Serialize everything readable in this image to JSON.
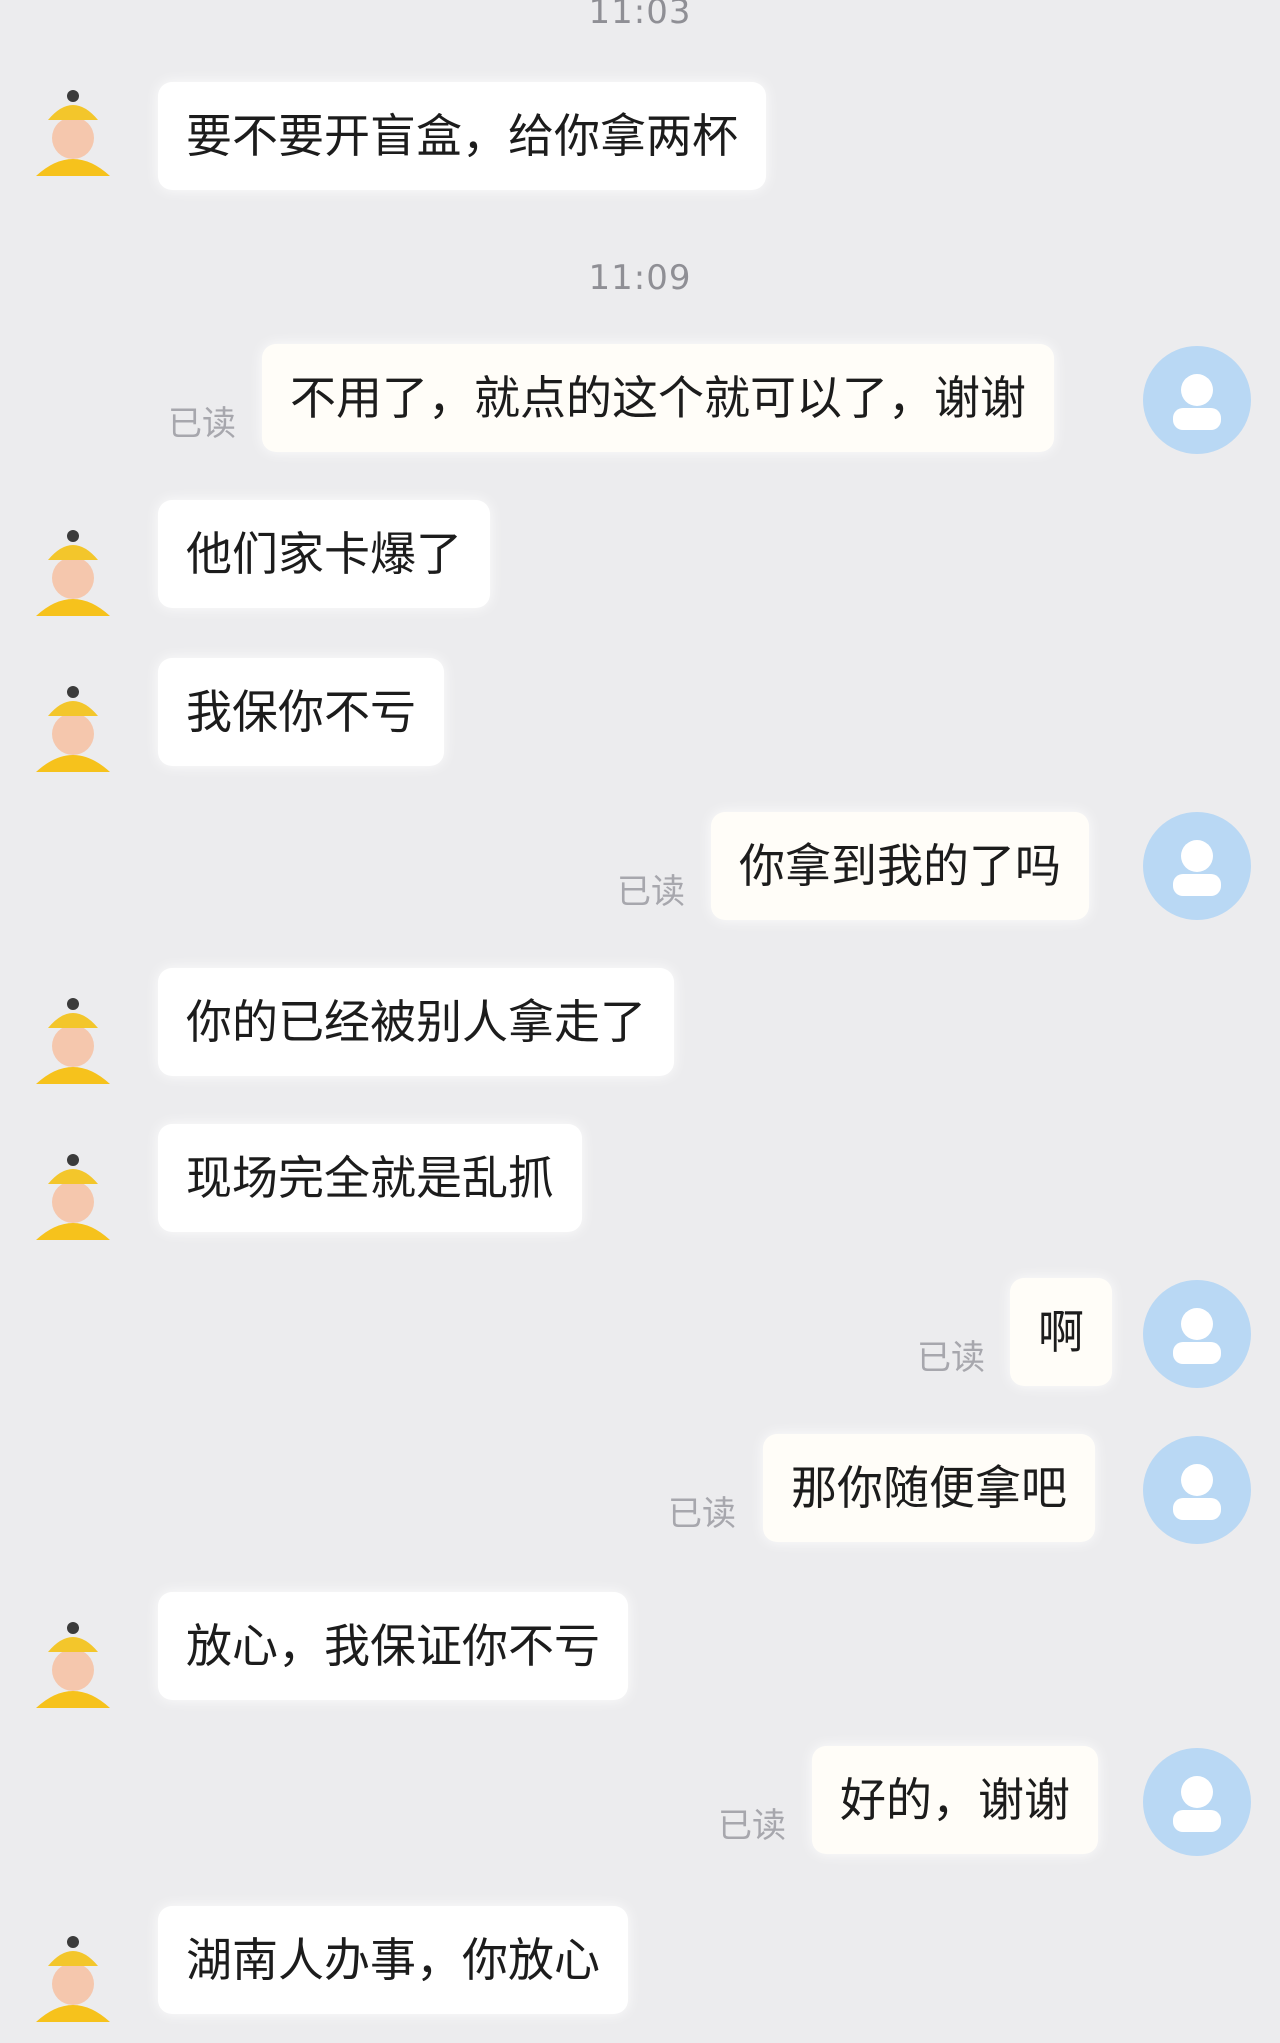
{
  "timestamps": [
    "11:03",
    "11:09"
  ],
  "read_label": "已读",
  "messages": [
    {
      "side": "in",
      "text": "要不要开盲盒，给你拿两杯"
    },
    {
      "side": "out",
      "text": "不用了，就点的这个就可以了，谢谢"
    },
    {
      "side": "in",
      "text": "他们家卡爆了"
    },
    {
      "side": "in",
      "text": "我保你不亏"
    },
    {
      "side": "out",
      "text": "你拿到我的了吗"
    },
    {
      "side": "in",
      "text": "你的已经被别人拿走了"
    },
    {
      "side": "in",
      "text": "现场完全就是乱抓"
    },
    {
      "side": "out",
      "text": "啊"
    },
    {
      "side": "out",
      "text": "那你随便拿吧"
    },
    {
      "side": "in",
      "text": "放心，我保证你不亏"
    },
    {
      "side": "out",
      "text": "好的，谢谢"
    },
    {
      "side": "in",
      "text": "湖南人办事，你放心"
    }
  ],
  "colors": {
    "background": "#ececee",
    "bubble": "#ffffff",
    "self_avatar": "#b9d8f4",
    "user_avatar_hat": "#f3c62b",
    "user_avatar_body": "#f6c21c"
  },
  "icons": {
    "incoming_avatar": "courier-avatar-icon",
    "outgoing_avatar": "person-icon"
  }
}
